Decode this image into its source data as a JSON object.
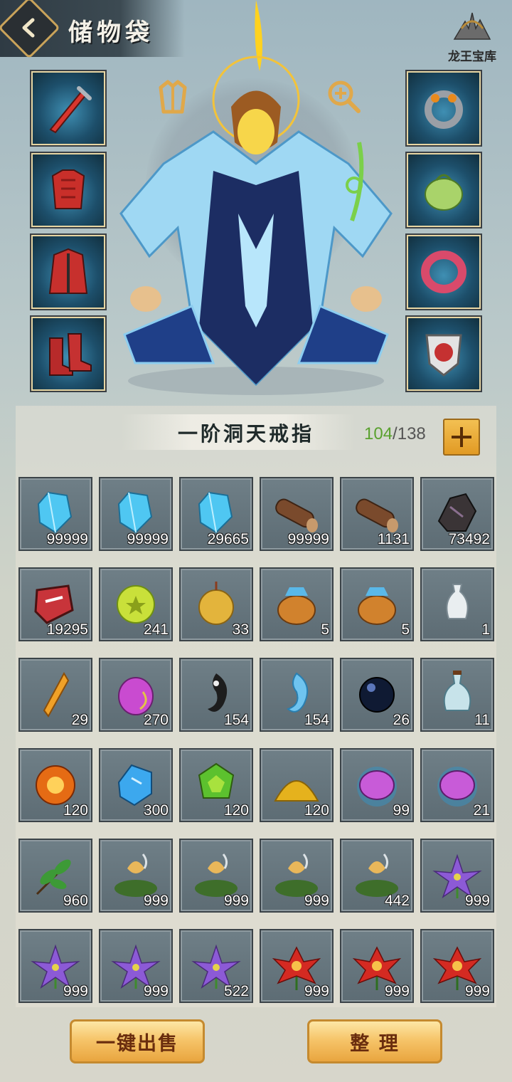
{
  "header": {
    "title": "储物袋",
    "logo_text": "龙王宝库"
  },
  "equipment": {
    "left": [
      {
        "name": "sword-icon",
        "color": "#d8362e"
      },
      {
        "name": "armor-icon",
        "color": "#c92f2a"
      },
      {
        "name": "robe-icon",
        "color": "#c7302d"
      },
      {
        "name": "boots-icon",
        "color": "#b72a2a"
      }
    ],
    "right": [
      {
        "name": "ring-icon",
        "color": "#9a9fa6"
      },
      {
        "name": "pouch-icon",
        "color": "#a9d36a"
      },
      {
        "name": "bracelet-icon",
        "color": "#d94a6b"
      },
      {
        "name": "shield-icon",
        "color": "#e3e3e3"
      }
    ]
  },
  "bag": {
    "title": "一阶洞天戒指",
    "used": "104",
    "separator": "/",
    "total": "138"
  },
  "items": [
    {
      "icon": "blue-crystal-icon",
      "qty": "99999",
      "color": "#4fc7f2"
    },
    {
      "icon": "blue-crystal-icon",
      "qty": "99999",
      "color": "#4fc7f2"
    },
    {
      "icon": "blue-crystal-icon",
      "qty": "29665",
      "color": "#4fc7f2"
    },
    {
      "icon": "wood-log-icon",
      "qty": "99999",
      "color": "#7a4a2c"
    },
    {
      "icon": "wood-log-icon",
      "qty": "1131",
      "color": "#7a4a2c"
    },
    {
      "icon": "dark-ore-icon",
      "qty": "73492",
      "color": "#3a3436"
    },
    {
      "icon": "red-token-icon",
      "qty": "19295",
      "color": "#c8343a"
    },
    {
      "icon": "green-orb-icon",
      "qty": "241",
      "color": "#c9e03a"
    },
    {
      "icon": "gold-pendant-icon",
      "qty": "33",
      "color": "#e3b43c"
    },
    {
      "icon": "treasure-bag-icon",
      "qty": "5",
      "color": "#d1822d"
    },
    {
      "icon": "treasure-bag-icon",
      "qty": "5",
      "color": "#d1822d"
    },
    {
      "icon": "white-vase-icon",
      "qty": "1",
      "color": "#e9eef0"
    },
    {
      "icon": "gold-shard-icon",
      "qty": "29",
      "color": "#f0a128"
    },
    {
      "icon": "purple-egg-icon",
      "qty": "270",
      "color": "#c94bd0"
    },
    {
      "icon": "black-yinyang-icon",
      "qty": "154",
      "color": "#1d1d1d"
    },
    {
      "icon": "blue-yinyang-icon",
      "qty": "154",
      "color": "#6fc4ef"
    },
    {
      "icon": "black-pearl-icon",
      "qty": "26",
      "color": "#0f1a33"
    },
    {
      "icon": "potion-flask-icon",
      "qty": "11",
      "color": "#c7e3ea"
    },
    {
      "icon": "fire-orb-icon",
      "qty": "120",
      "color": "#e56b14"
    },
    {
      "icon": "blue-gem-icon",
      "qty": "300",
      "color": "#3ca8ee"
    },
    {
      "icon": "green-gem-icon",
      "qty": "120",
      "color": "#5cc12e"
    },
    {
      "icon": "gold-pile-icon",
      "qty": "120",
      "color": "#e5b21d"
    },
    {
      "icon": "purple-stone-icon",
      "qty": "99",
      "color": "#c85bd8"
    },
    {
      "icon": "purple-stone-icon",
      "qty": "21",
      "color": "#c85bd8"
    },
    {
      "icon": "green-leaf-icon",
      "qty": "960",
      "color": "#3d9a36"
    },
    {
      "icon": "golden-lily-icon",
      "qty": "999",
      "color": "#e9b75a"
    },
    {
      "icon": "golden-lily-icon",
      "qty": "999",
      "color": "#e9b75a"
    },
    {
      "icon": "golden-lily-icon",
      "qty": "999",
      "color": "#e9b75a"
    },
    {
      "icon": "golden-lily-icon",
      "qty": "442",
      "color": "#e9b75a"
    },
    {
      "icon": "purple-flower-icon",
      "qty": "999",
      "color": "#8c5ad6"
    },
    {
      "icon": "purple-flower-icon",
      "qty": "999",
      "color": "#8c5ad6"
    },
    {
      "icon": "purple-flower-icon",
      "qty": "999",
      "color": "#8c5ad6"
    },
    {
      "icon": "purple-flower-icon",
      "qty": "522",
      "color": "#8c5ad6"
    },
    {
      "icon": "red-flower-icon",
      "qty": "999",
      "color": "#d42a22"
    },
    {
      "icon": "red-flower-icon",
      "qty": "999",
      "color": "#d42a22"
    },
    {
      "icon": "red-flower-icon",
      "qty": "999",
      "color": "#d42a22"
    }
  ],
  "buttons": {
    "sell_all": "一键出售",
    "sort": "整 理"
  }
}
